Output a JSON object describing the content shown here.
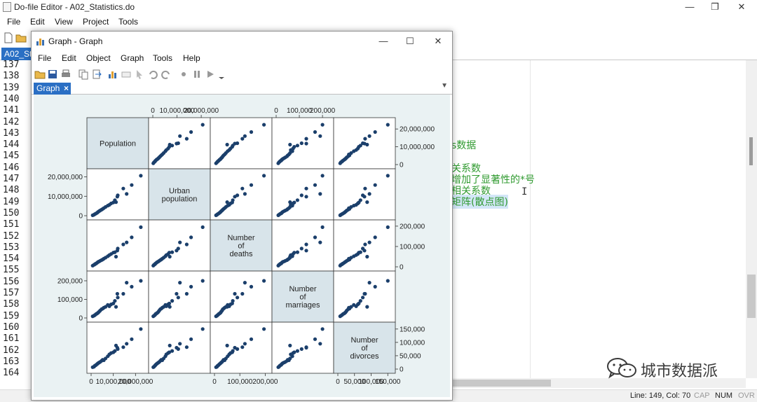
{
  "editor": {
    "title": "Do-file Editor - A02_Statistics.do",
    "menu": [
      "File",
      "Edit",
      "View",
      "Project",
      "Tools"
    ],
    "tab_label": "A02_St",
    "line_numbers": [
      "137",
      "138",
      "139",
      "140",
      "141",
      "142",
      "143",
      "144",
      "145",
      "146",
      "147",
      "148",
      "149",
      "150",
      "151",
      "152",
      "153",
      "154",
      "155",
      "156",
      "157",
      "158",
      "159",
      "160",
      "161",
      "162",
      "163",
      "164"
    ],
    "code_fragments": [
      {
        "text": "s数据"
      },
      {
        "text": "关系数"
      },
      {
        "text": "增加了显著性的*号"
      },
      {
        "text": "相关系数"
      },
      {
        "text": "矩阵(散点图)"
      }
    ],
    "status": {
      "position": "Line: 149, Col: 70",
      "cap": "CAP",
      "num": "NUM",
      "ovr": "OVR"
    }
  },
  "watermark": {
    "text": "城市数据派",
    "icon": "wechat-icon"
  },
  "graph_window": {
    "title": "Graph - Graph",
    "menu": [
      "File",
      "Edit",
      "Object",
      "Graph",
      "Tools",
      "Help"
    ],
    "tab_label": "Graph",
    "tab_close": "×",
    "toolbar_icons": [
      "open-icon",
      "save-icon",
      "print-icon",
      "copy-icon",
      "export-icon",
      "chart-editor-icon",
      "rename-icon",
      "pointer-icon",
      "undo-icon",
      "redo-icon",
      "record-icon",
      "pause-icon",
      "play-icon",
      "dropdown-icon"
    ]
  },
  "chart_data": {
    "type": "scatter",
    "subtype": "scatter matrix",
    "colors": {
      "marker": "#1b3f6b",
      "diag_fill": "#d8e4ea",
      "background": "#eaf2f3"
    },
    "variables": [
      {
        "label": [
          "Population"
        ],
        "range": [
          0,
          24000000
        ],
        "ticks": [
          0,
          10000000,
          20000000
        ],
        "tick_labels": [
          "0",
          "10,000,000",
          "20,000,000"
        ]
      },
      {
        "label": [
          "Urban",
          "population"
        ],
        "range": [
          0,
          22000000
        ],
        "ticks": [
          0,
          10000000,
          20000000
        ],
        "tick_labels": [
          "0",
          "10,000,000",
          "20,000,000"
        ]
      },
      {
        "label": [
          "Number",
          "of",
          "deaths"
        ],
        "range": [
          0,
          210000
        ],
        "ticks": [
          0,
          100000,
          200000
        ],
        "tick_labels": [
          "0",
          "100,000",
          "200,000"
        ]
      },
      {
        "label": [
          "Number",
          "of",
          "marriages"
        ],
        "range": [
          0,
          230000
        ],
        "ticks": [
          0,
          100000,
          200000
        ],
        "tick_labels": [
          "0",
          "100,000",
          "200,000"
        ]
      },
      {
        "label": [
          "Number",
          "of",
          "divorces"
        ],
        "range": [
          0,
          160000
        ],
        "ticks": [
          0,
          50000,
          100000,
          150000
        ],
        "tick_labels": [
          "0",
          "50,000",
          "100,000",
          "150,000"
        ]
      }
    ],
    "observations": [
      [
        700000,
        200000,
        6000,
        9000,
        7000
      ],
      [
        1300000,
        500000,
        10000,
        12000,
        9000
      ],
      [
        1600000,
        800000,
        12000,
        15000,
        12000
      ],
      [
        2000000,
        1000000,
        15000,
        18000,
        14000
      ],
      [
        2300000,
        1200000,
        17000,
        22000,
        16000
      ],
      [
        2700000,
        1500000,
        20000,
        24000,
        19000
      ],
      [
        3000000,
        1800000,
        23000,
        27000,
        21000
      ],
      [
        3300000,
        2100000,
        25000,
        30000,
        23000
      ],
      [
        3700000,
        2400000,
        27000,
        35000,
        25000
      ],
      [
        4100000,
        2700000,
        30000,
        40000,
        27000
      ],
      [
        4700000,
        3100000,
        33000,
        47000,
        31000
      ],
      [
        5200000,
        3500000,
        36000,
        50000,
        35000
      ],
      [
        5700000,
        3900000,
        40000,
        55000,
        33000
      ],
      [
        6500000,
        4500000,
        45000,
        60000,
        40000
      ],
      [
        7500000,
        5200000,
        52000,
        70000,
        48000
      ],
      [
        8200000,
        5600000,
        58000,
        63000,
        55000
      ],
      [
        9000000,
        6300000,
        63000,
        73000,
        60000
      ],
      [
        10000000,
        6800000,
        70000,
        78000,
        63000
      ],
      [
        10700000,
        8000000,
        72000,
        92000,
        68000
      ],
      [
        11200000,
        7000000,
        50000,
        60000,
        88000
      ],
      [
        11800000,
        9800000,
        80000,
        130000,
        80000
      ],
      [
        12000000,
        10500000,
        90000,
        110000,
        75000
      ],
      [
        14500000,
        14000000,
        110000,
        130000,
        82000
      ],
      [
        16000000,
        11200000,
        120000,
        190000,
        95000
      ],
      [
        18300000,
        15800000,
        145000,
        168000,
        112000
      ],
      [
        22400000,
        20600000,
        195000,
        200000,
        150000
      ]
    ]
  }
}
